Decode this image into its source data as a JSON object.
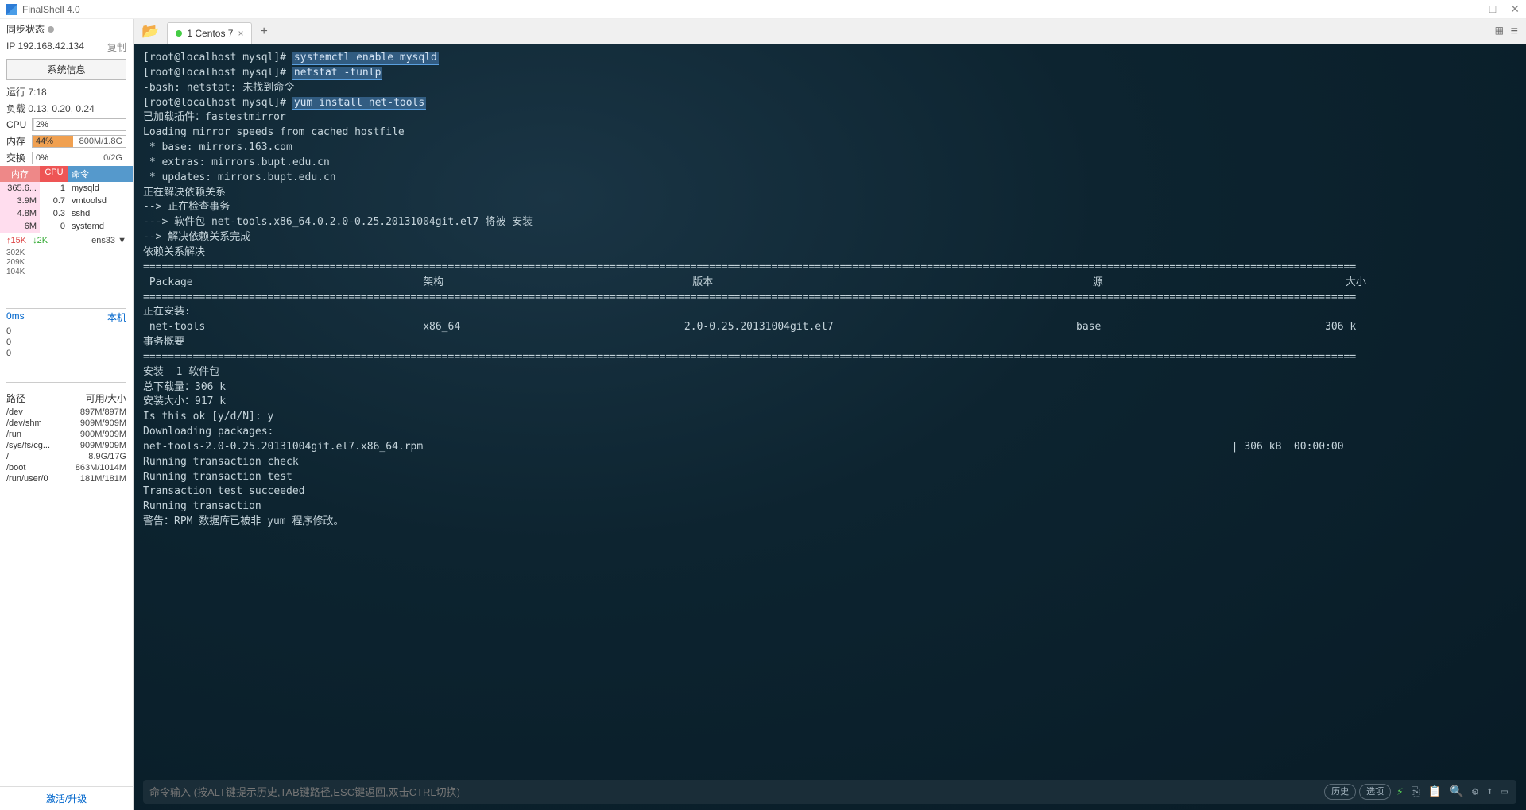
{
  "window": {
    "title": "FinalShell 4.0"
  },
  "sidebar": {
    "sync_label": "同步状态",
    "ip": "IP  192.168.42.134",
    "copy": "复制",
    "sysinfo_btn": "系统信息",
    "uptime": "运行 7:18",
    "load": "负载 0.13, 0.20, 0.24",
    "cpu_label": "CPU",
    "cpu_pct": "2%",
    "mem_label": "内存",
    "mem_pct": "44%",
    "mem_val": "800M/1.8G",
    "swap_label": "交换",
    "swap_pct": "0%",
    "swap_val": "0/2G",
    "proc_head_mem": "内存",
    "proc_head_cpu": "CPU",
    "proc_head_cmd": "命令",
    "procs": [
      {
        "mem": "365.6...",
        "cpu": "1",
        "cmd": "mysqld"
      },
      {
        "mem": "3.9M",
        "cpu": "0.7",
        "cmd": "vmtoolsd"
      },
      {
        "mem": "4.8M",
        "cpu": "0.3",
        "cmd": "sshd"
      },
      {
        "mem": "6M",
        "cpu": "0",
        "cmd": "systemd"
      }
    ],
    "net_up": "↑15K",
    "net_down": "↓2K",
    "iface": "ens33 ▼",
    "scale": [
      "302K",
      "209K",
      "104K"
    ],
    "latency_ms": "0ms",
    "latency_host": "本机",
    "zeros": [
      "0",
      "0",
      "0"
    ],
    "disk_head_path": "路径",
    "disk_head_size": "可用/大小",
    "disks": [
      {
        "p": "/dev",
        "s": "897M/897M"
      },
      {
        "p": "/dev/shm",
        "s": "909M/909M"
      },
      {
        "p": "/run",
        "s": "900M/909M"
      },
      {
        "p": "/sys/fs/cg...",
        "s": "909M/909M"
      },
      {
        "p": "/",
        "s": "8.9G/17G"
      },
      {
        "p": "/boot",
        "s": "863M/1014M"
      },
      {
        "p": "/run/user/0",
        "s": "181M/181M"
      }
    ],
    "activate": "激活/升级"
  },
  "tabs": {
    "active_label": "1 Centos 7"
  },
  "terminal": {
    "prompt": "[root@localhost mysql]#",
    "cmd1": "systemctl enable mysqld",
    "cmd2": "netstat -tunlp",
    "bash_err": "-bash: netstat: 未找到命令",
    "cmd3": "yum install net-tools",
    "lines_a": [
      "已加载插件：fastestmirror",
      "Loading mirror speeds from cached hostfile",
      " * base: mirrors.163.com",
      " * extras: mirrors.bupt.edu.cn",
      " * updates: mirrors.bupt.edu.cn",
      "正在解决依赖关系",
      "--> 正在检查事务",
      "---> 软件包 net-tools.x86_64.0.2.0-0.25.20131004git.el7 将被 安装",
      "--> 解决依赖关系完成",
      "",
      "依赖关系解决",
      ""
    ],
    "yum_header": {
      "pkg": " Package",
      "arch": "架构",
      "ver": "版本",
      "repo": "源",
      "size": "大小"
    },
    "yum_install_label": "正在安装:",
    "yum_row": {
      "pkg": " net-tools",
      "arch": "x86_64",
      "ver": "2.0-0.25.20131004git.el7",
      "repo": "base",
      "size": "306 k"
    },
    "lines_b": [
      "",
      "事务概要",
      ""
    ],
    "lines_c": [
      "安装  1 软件包",
      "",
      "总下载量：306 k",
      "安装大小：917 k",
      "Is this ok [y/d/N]: y",
      "Downloading packages:"
    ],
    "dl_line_left": "net-tools-2.0-0.25.20131004git.el7.x86_64.rpm",
    "dl_line_right": "| 306 kB  00:00:00",
    "lines_d": [
      "Running transaction check",
      "Running transaction test",
      "Transaction test succeeded",
      "Running transaction",
      "警告：RPM 数据库已被非 yum 程序修改。"
    ],
    "input_placeholder": "命令输入 (按ALT键提示历史,TAB键路径,ESC键返回,双击CTRL切换)",
    "btn_history": "历史",
    "btn_options": "选项"
  }
}
